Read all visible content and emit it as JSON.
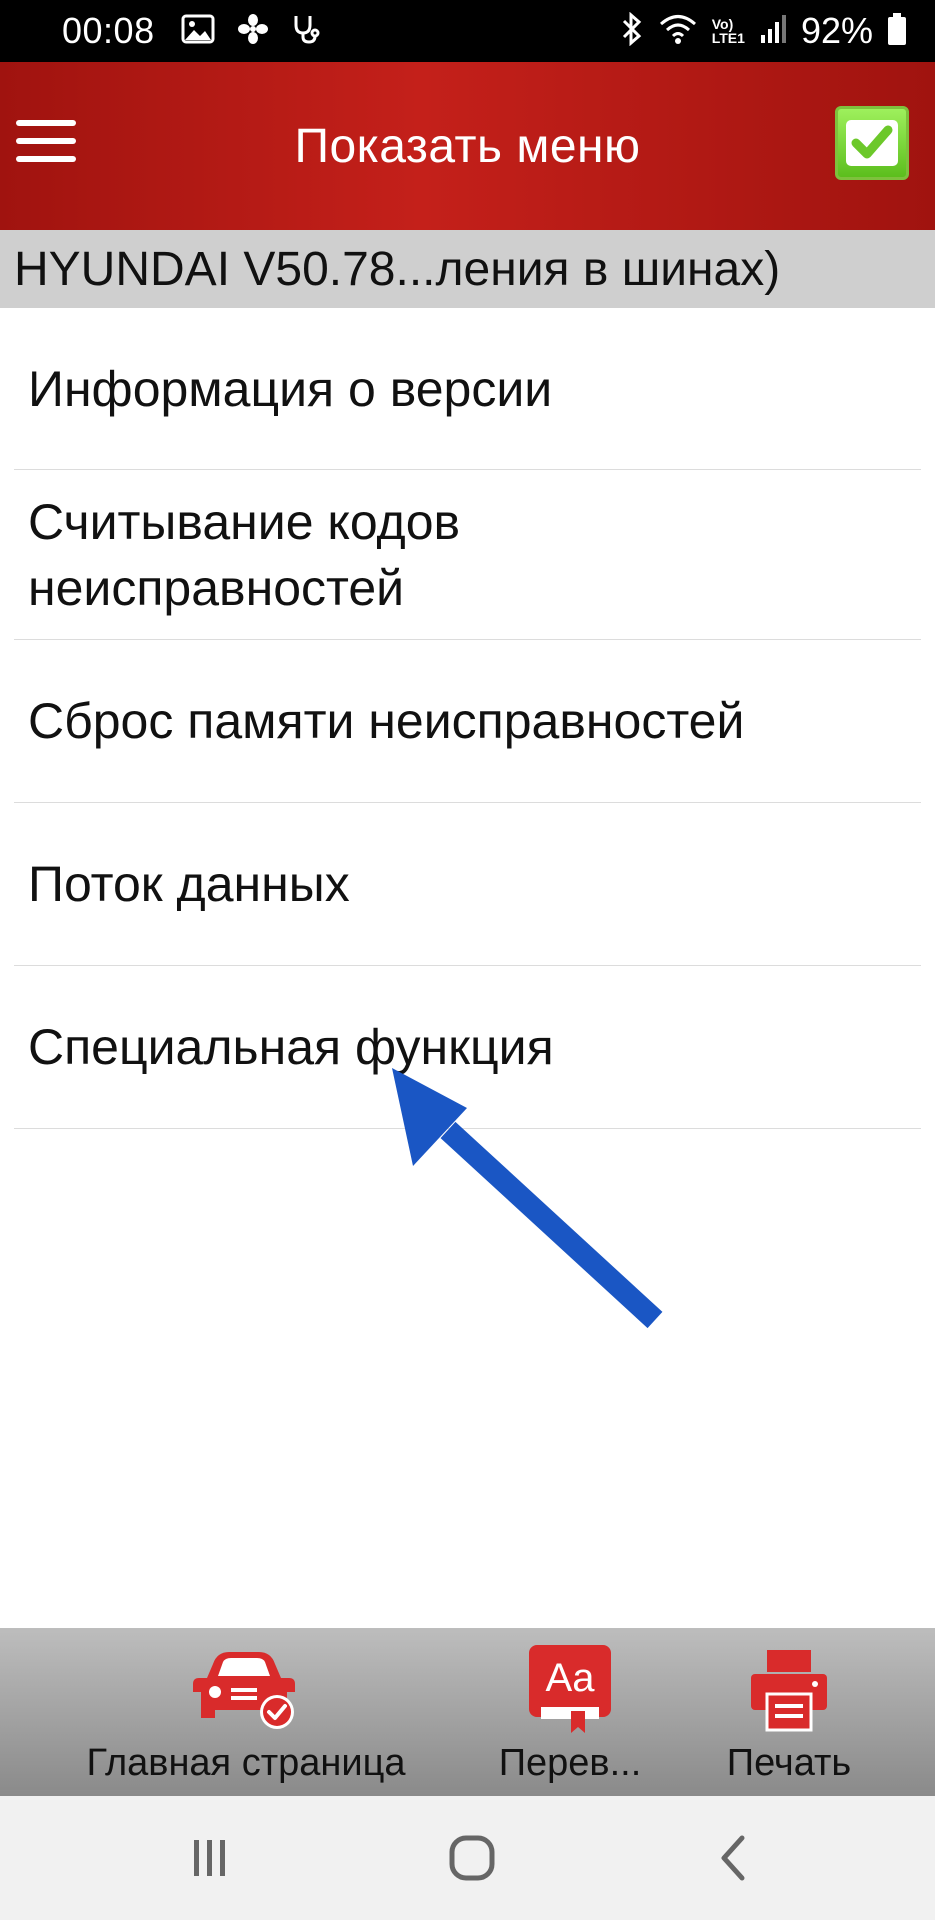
{
  "status_bar": {
    "time": "00:08",
    "battery": "92%",
    "left_icons": [
      "gallery-icon",
      "fan-icon",
      "stethoscope-icon"
    ],
    "right_icons": [
      "bluetooth-icon",
      "wifi-icon",
      "volte-icon",
      "signal-icon",
      "battery-icon"
    ],
    "volte_text": "Vo)",
    "lte_text": "LTE1"
  },
  "header": {
    "title": "Показать меню",
    "menu_icon": "hamburger-icon",
    "confirm_icon": "check-icon"
  },
  "path_bar": {
    "text": "HYUNDAI V50.78...ления в шинах)"
  },
  "menu": {
    "items": [
      {
        "label": "Информация о версии"
      },
      {
        "label": "Считывание кодов неисправностей"
      },
      {
        "label": "Сброс памяти неисправностей"
      },
      {
        "label": "Поток данных"
      },
      {
        "label": "Специальная функция"
      }
    ]
  },
  "annotation": {
    "arrow_color": "#1a56c4"
  },
  "toolbar": {
    "home_label": "Главная страница",
    "translate_label": "Перев...",
    "translate_icon_text": "Aa",
    "print_label": "Печать",
    "accent_color": "#d92b2b"
  },
  "colors": {
    "header": "#b3160f",
    "path_bar": "#cfcfcf",
    "confirm": "#6fcf2a"
  }
}
